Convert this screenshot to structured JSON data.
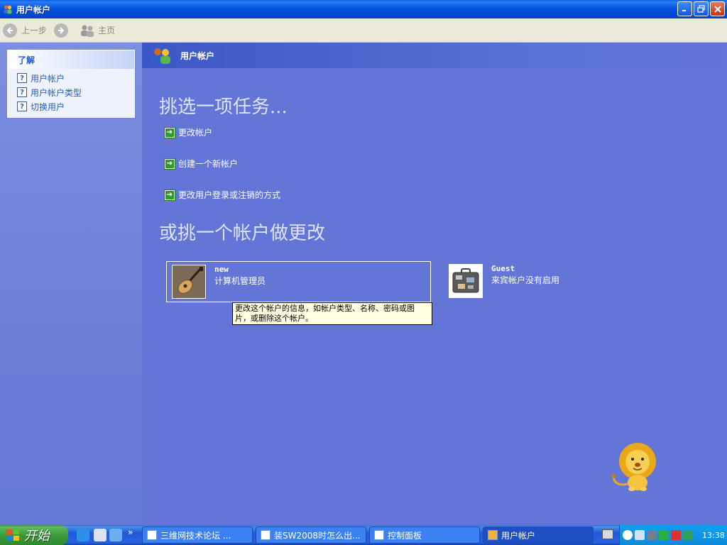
{
  "window": {
    "title": "用户帐户"
  },
  "toolbar": {
    "back_label": "上一步",
    "home_label": "主页"
  },
  "sidebar": {
    "heading": "了解",
    "items": [
      {
        "label": "用户帐户"
      },
      {
        "label": "用户帐户类型"
      },
      {
        "label": "切换用户"
      }
    ]
  },
  "main": {
    "header_title": "用户帐户",
    "task_heading": "挑选一项任务...",
    "tasks": [
      {
        "label": "更改帐户"
      },
      {
        "label": "创建一个新帐户"
      },
      {
        "label": "更改用户登录或注销的方式"
      }
    ],
    "pick_heading": "或挑一个帐户做更改",
    "accounts": [
      {
        "name": "new",
        "description": "计算机管理员",
        "picture": "guitar"
      },
      {
        "name": "Guest",
        "description": "来宾帐户没有启用",
        "picture": "suitcase"
      }
    ],
    "tooltip": "更改这个帐户的信息，如帐户类型、名称、密码或图片，或删除这个帐户。"
  },
  "taskbar": {
    "start_label": "开始",
    "buttons": [
      {
        "label": "三维网技术论坛 ..."
      },
      {
        "label": "装SW2008时怎么出..."
      },
      {
        "label": "控制面板"
      },
      {
        "label": "用户帐户"
      }
    ],
    "clock": "13:38"
  },
  "colors": {
    "background": "#6375d6",
    "titlebar": "#0354e0",
    "taskbar": "#2157d7",
    "start": "#3c9a3c",
    "link": "#215dc6"
  }
}
